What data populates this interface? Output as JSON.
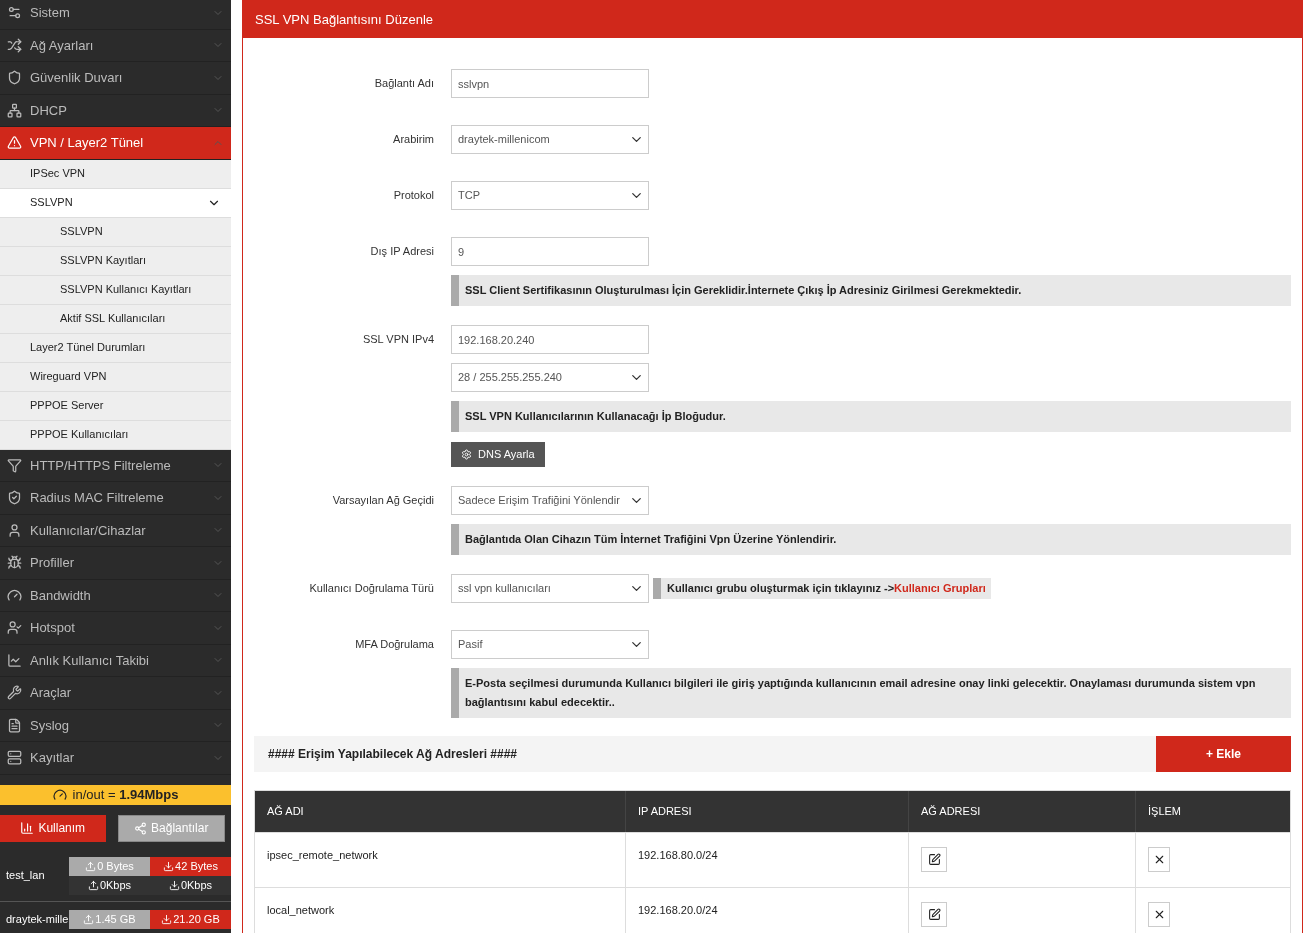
{
  "sidebar": {
    "items": [
      {
        "label": "Sistem",
        "selected": false,
        "expanded": false
      },
      {
        "label": "Ağ Ayarları",
        "selected": false,
        "expanded": false
      },
      {
        "label": "Güvenlik Duvarı",
        "selected": false,
        "expanded": false
      },
      {
        "label": "DHCP",
        "selected": false,
        "expanded": false
      },
      {
        "label": "VPN / Layer2 Tünel",
        "selected": true,
        "expanded": true,
        "children": [
          {
            "label": "IPSec VPN",
            "selected": false,
            "expanded": false
          },
          {
            "label": "SSLVPN",
            "selected": true,
            "expanded": true,
            "children": [
              {
                "label": "SSLVPN",
                "selected": false
              },
              {
                "label": "SSLVPN Kayıtları",
                "selected": false
              },
              {
                "label": "SSLVPN Kullanıcı Kayıtları",
                "selected": false
              },
              {
                "label": "Aktif SSL Kullanıcıları",
                "selected": false
              }
            ]
          },
          {
            "label": "Layer2 Tünel Durumları",
            "selected": false,
            "expanded": false
          },
          {
            "label": "Wireguard VPN",
            "selected": false,
            "expanded": false
          },
          {
            "label": "PPPOE Server",
            "selected": false,
            "expanded": false
          },
          {
            "label": "PPPOE Kullanıcıları",
            "selected": false,
            "expanded": false
          }
        ]
      },
      {
        "label": "HTTP/HTTPS Filtreleme",
        "selected": false,
        "expanded": false
      },
      {
        "label": "Radius MAC Filtreleme",
        "selected": false,
        "expanded": false
      },
      {
        "label": "Kullanıcılar/Cihazlar",
        "selected": false,
        "expanded": false
      },
      {
        "label": "Profiller",
        "selected": false,
        "expanded": false
      },
      {
        "label": "Bandwidth",
        "selected": false,
        "expanded": false
      },
      {
        "label": "Hotspot",
        "selected": false,
        "expanded": false
      },
      {
        "label": "Anlık Kullanıcı Takibi",
        "selected": false,
        "expanded": false
      },
      {
        "label": "Araçlar",
        "selected": false,
        "expanded": false
      },
      {
        "label": "Syslog",
        "selected": false,
        "expanded": false
      },
      {
        "label": "Kayıtlar",
        "selected": false,
        "expanded": false
      }
    ]
  },
  "throughput": {
    "label": "in/out = ",
    "value": "1.94Mbps"
  },
  "usage_tabs": [
    {
      "label": "Kullanım",
      "selected": true
    },
    {
      "label": "Bağlantılar",
      "selected": false
    }
  ],
  "interfaces": [
    {
      "name": "test_lan",
      "up_total": "0 Bytes",
      "down_total": "42 Bytes",
      "up_rate": "0Kbps",
      "down_rate": "0Kbps"
    },
    {
      "name": "draytek-mille",
      "up_total": "1.45 GB",
      "down_total": "21.20 GB"
    }
  ],
  "panel": {
    "title": "SSL VPN Bağlantısını Düzenle",
    "form": [
      {
        "kind": "input",
        "label": "Bağlantı Adı",
        "value": "sslvpn"
      },
      {
        "kind": "select",
        "label": "Arabirim",
        "value": "draytek-millenicom"
      },
      {
        "kind": "select",
        "label": "Protokol",
        "value": "TCP"
      },
      {
        "kind": "input",
        "label": "Dış IP Adresi",
        "value": "9"
      },
      {
        "kind": "note",
        "text": "SSL Client Sertifikasının Oluşturulması İçin Gereklidir.İnternete Çıkış İp Adresiniz Girilmesi Gerekmektedir."
      },
      {
        "kind": "input",
        "label": "SSL VPN IPv4",
        "value": "192.168.20.240"
      },
      {
        "kind": "select",
        "value": "28 / 255.255.255.240"
      },
      {
        "kind": "note",
        "text": "SSL VPN Kullanıcılarının Kullanacağı İp Bloğudur."
      },
      {
        "kind": "button",
        "text": "DNS Ayarla"
      },
      {
        "kind": "select",
        "label": "Varsayılan Ağ Geçidi",
        "value": "Sadece Erişim Trafiğini Yönlendir"
      },
      {
        "kind": "note",
        "text": "Bağlantıda Olan Cihazın Tüm İnternet Trafiğini Vpn Üzerine Yönlendirir."
      },
      {
        "kind": "select",
        "label": "Kullanıcı Doğrulama Türü",
        "value": "ssl vpn kullanıcıları",
        "hint": "Kullanıcı grubu oluşturmak için tıklayınız ->",
        "hint_link": "Kullanıcı Grupları"
      },
      {
        "kind": "select",
        "label": "MFA Doğrulama",
        "value": "Pasif"
      },
      {
        "kind": "note",
        "text": "E-Posta seçilmesi durumunda Kullanıcı bilgileri ile giriş yaptığında kullanıcının email adresine onay linki gelecektir. Onaylaması durumunda sistem vpn bağlantısını kabul edecektir.."
      }
    ],
    "section_title": "#### Erişim Yapılabilecek Ağ Adresleri ####",
    "add_button": "+ Ekle",
    "table": {
      "columns": [
        "AĞ ADI",
        "IP ADRESI",
        "AĞ ADRESI",
        "İŞLEM"
      ],
      "rows": [
        {
          "name": "ipsec_remote_network",
          "ip": "192.168.80.0/24"
        },
        {
          "name": "local_network",
          "ip": "192.168.20.0/24"
        }
      ]
    }
  }
}
